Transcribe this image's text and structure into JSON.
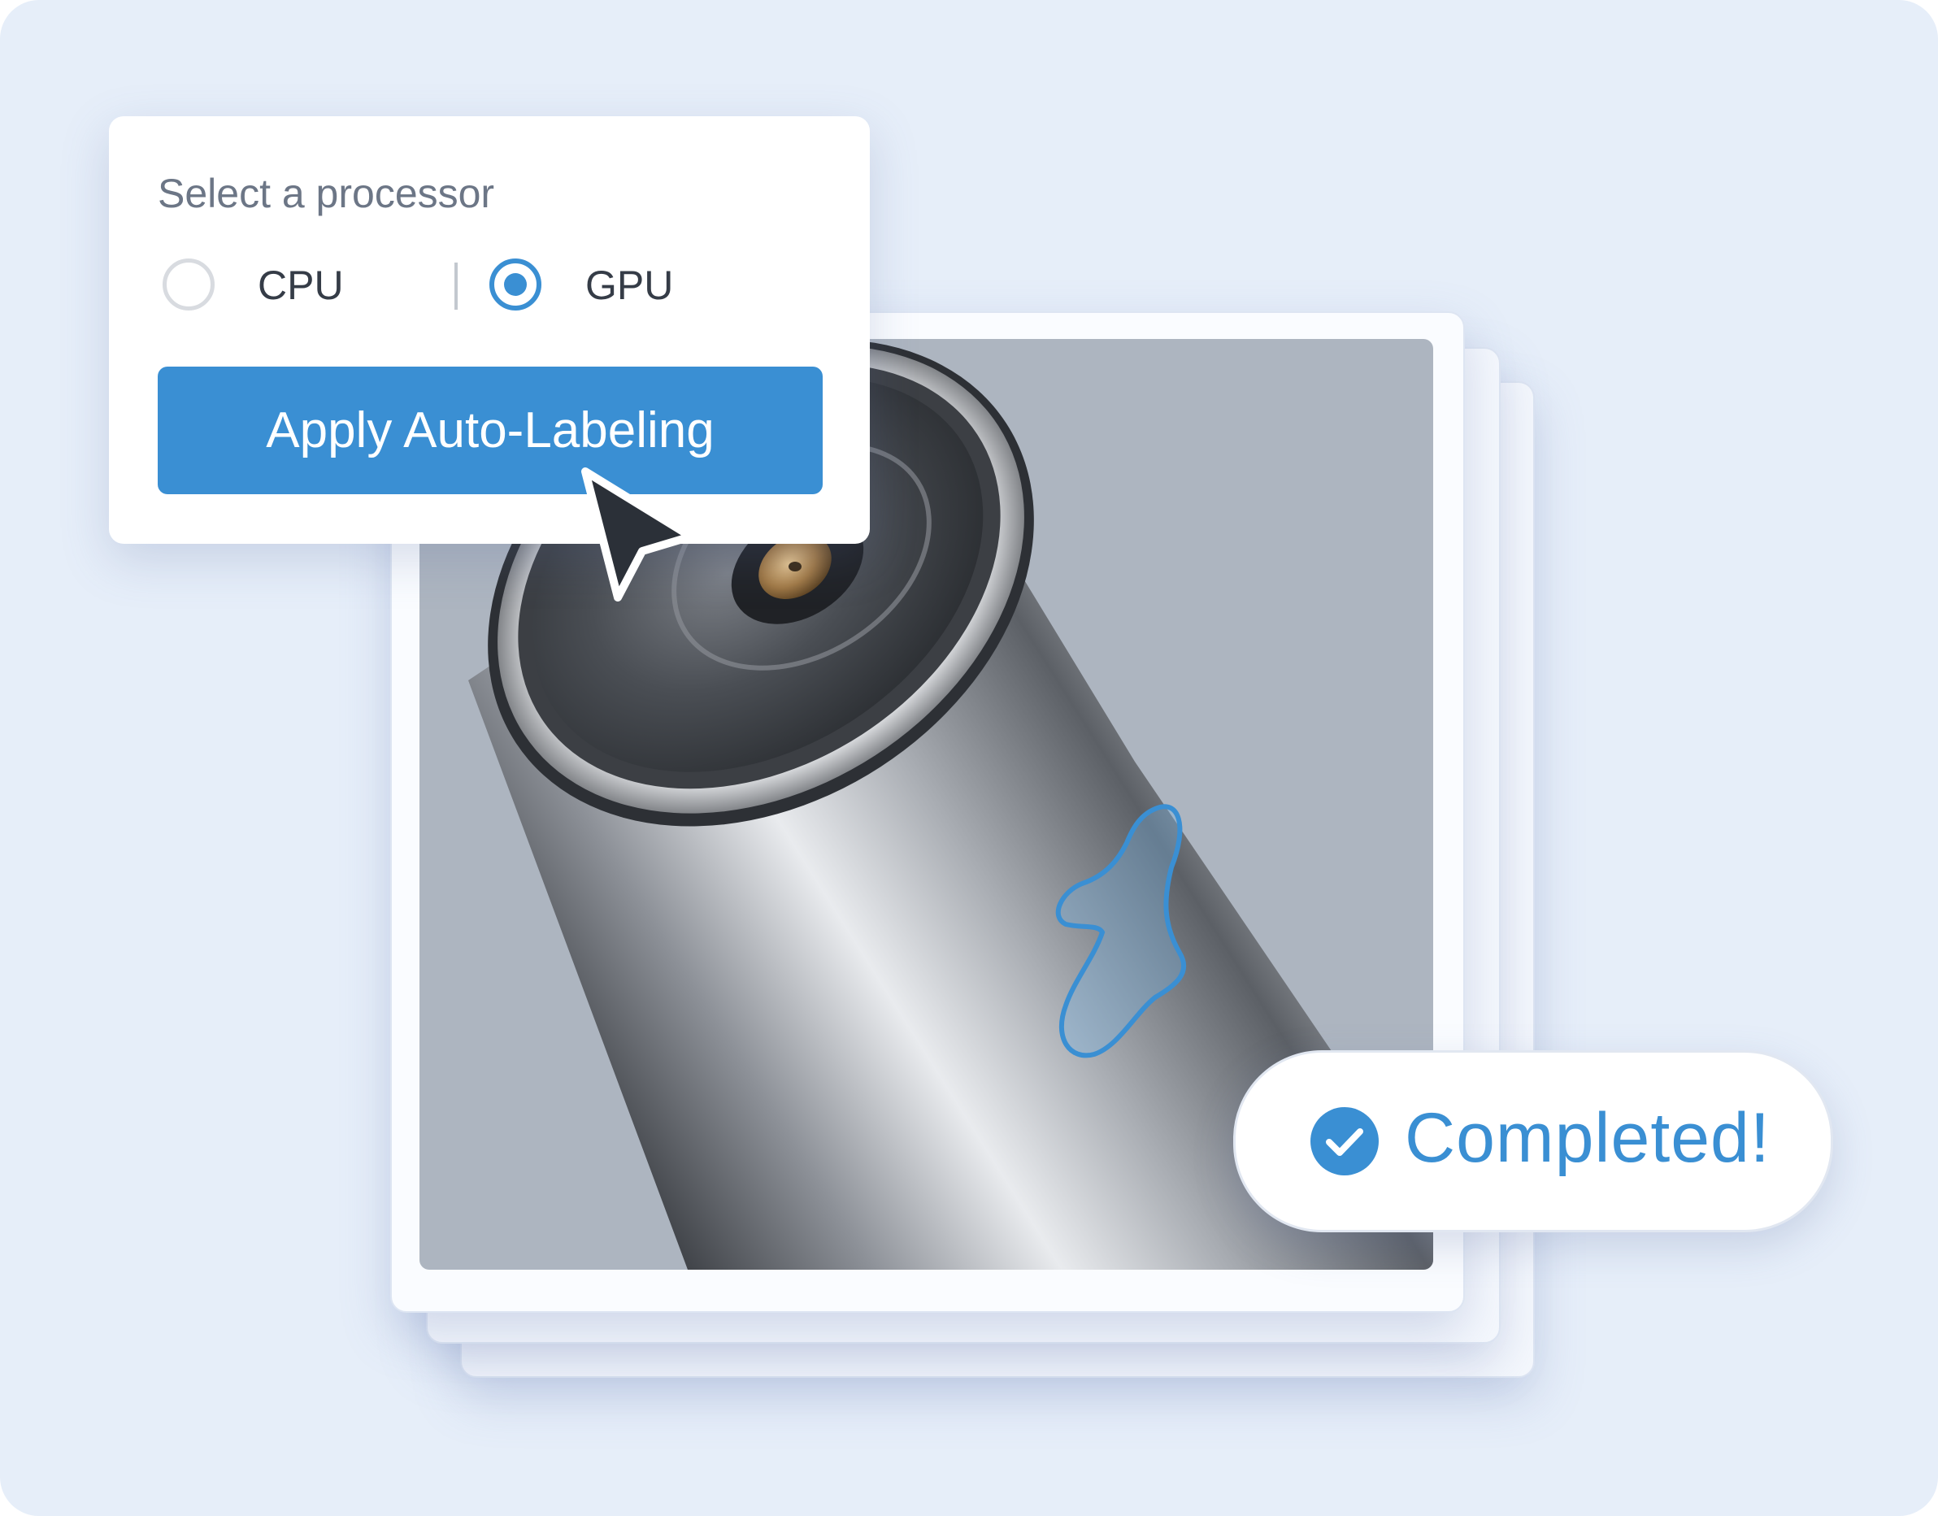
{
  "processor_panel": {
    "title": "Select a processor",
    "options": [
      {
        "label": "CPU",
        "selected": false
      },
      {
        "label": "GPU",
        "selected": true
      }
    ],
    "apply_button_label": "Apply Auto-Labeling"
  },
  "status": {
    "label": "Completed!",
    "icon": "check-circle-icon"
  },
  "colors": {
    "accent": "#3a8fd3",
    "background": "#e6eef9",
    "image_background": "#adb5c0"
  }
}
